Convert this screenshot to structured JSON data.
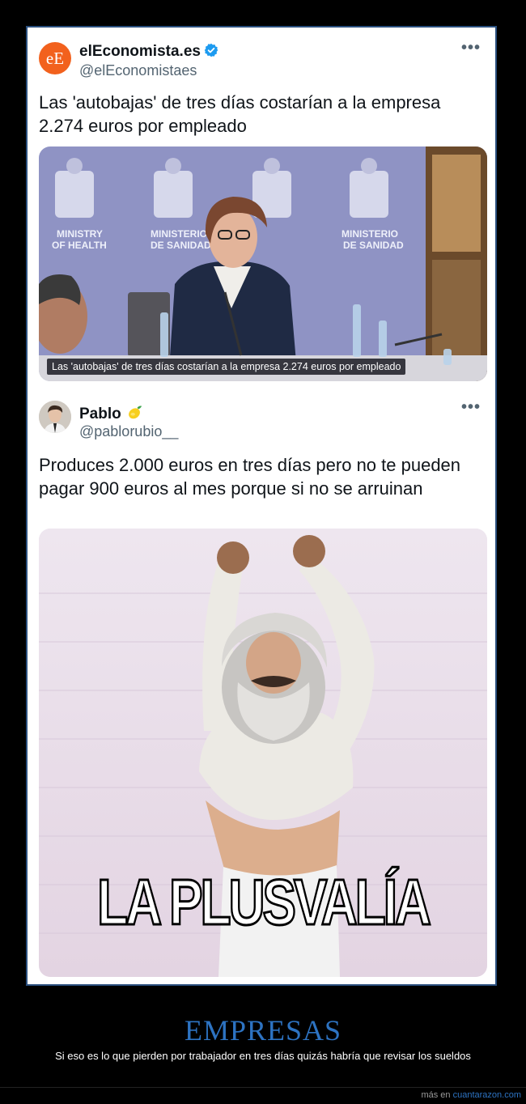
{
  "tweet1": {
    "author_name": "elEconomista.es",
    "handle": "@elEconomistaes",
    "avatar_initials": "eE",
    "more_label": "•••",
    "text": "Las 'autobajas' de tres días costarían a la empresa 2.274 euros por empleado",
    "media": {
      "caption": "Las 'autobajas' de tres días costarían a la empresa 2.274 euros por empleado",
      "backdrop_text_1": "MINISTRY",
      "backdrop_text_2": "OF HEALTH",
      "backdrop_text_3": "MINISTERIO",
      "backdrop_text_4": "DE SANIDAD"
    }
  },
  "tweet2": {
    "author_name": "Pablo",
    "handle": "@pablorubio__",
    "more_label": "•••",
    "text": "Produces 2.000 euros en tres días pero no te pueden pagar 900 euros al mes porque si no se arruinan",
    "media": {
      "meme_text": "LA PLUSVALÍA"
    }
  },
  "footer": {
    "title": "EMPRESAS",
    "subtitle": "Si eso es lo que pierden por trabajador en tres días quizás habría que revisar los sueldos",
    "source_prefix": "más en",
    "source_link": "cuantarazon.com"
  },
  "colors": {
    "background": "#000000",
    "frame_border": "#2a4f7e",
    "accent_blue": "#2d73c2",
    "verified_blue": "#1d9bf0",
    "brand_orange": "#f2611d"
  },
  "icons": [
    "verified-badge-icon",
    "lemon-emoji-icon",
    "more-options-icon"
  ]
}
